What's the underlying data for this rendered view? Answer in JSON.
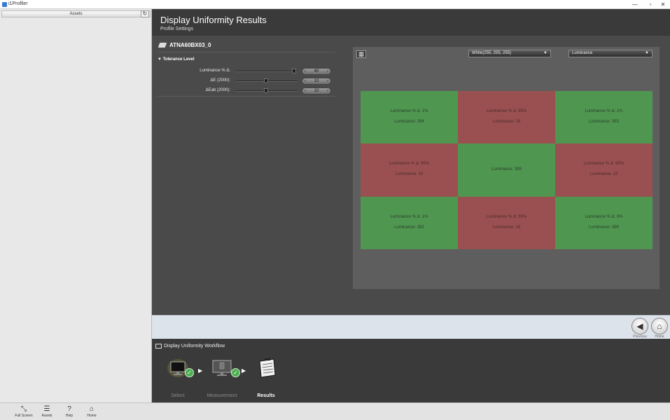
{
  "window": {
    "app_name": "i1Profiler"
  },
  "sidebar": {
    "header": "Assets"
  },
  "header": {
    "title": "Display Uniformity Results",
    "subtitle": "Profile Settings"
  },
  "device": {
    "name": "ATNA60BX03_0"
  },
  "tolerance": {
    "heading": "Tolerance Level",
    "rows": [
      {
        "label": "Luminance % Δ:",
        "value": "40",
        "level": 1.0
      },
      {
        "label": "ΔE (2000):",
        "value": "10",
        "level": 0.5
      },
      {
        "label": "ΔEab (2000):",
        "value": "10",
        "level": 0.5
      }
    ]
  },
  "grid": {
    "color_dropdown": "White(255, 255, 255)",
    "metric_dropdown": "Luminance",
    "cells": [
      {
        "status": "pass",
        "delta": "Luminance % Δ:  1%",
        "luminance": "Luminance:  394"
      },
      {
        "status": "fail",
        "delta": "Luminance % Δ:  95%",
        "luminance": "Luminance:  19"
      },
      {
        "status": "pass",
        "delta": "Luminance % Δ:  1%",
        "luminance": "Luminance:  393"
      },
      {
        "status": "fail",
        "delta": "Luminance % Δ:  95%",
        "luminance": "Luminance:  19"
      },
      {
        "status": "pass",
        "delta": "",
        "luminance": "Luminance:  398"
      },
      {
        "status": "fail",
        "delta": "Luminance % Δ:  95%",
        "luminance": "Luminance:  19"
      },
      {
        "status": "pass",
        "delta": "Luminance % Δ:  1%",
        "luminance": "Luminance:  392"
      },
      {
        "status": "fail",
        "delta": "Luminance % Δ:  95%",
        "luminance": "Luminance:  19"
      },
      {
        "status": "pass",
        "delta": "Luminance % Δ:  0%",
        "luminance": "Luminance:  396"
      }
    ],
    "colors": {
      "pass": "#4f9650",
      "fail": "#9a5050"
    }
  },
  "nav": {
    "previous": "Previous",
    "home": "Home"
  },
  "workflow": {
    "title": "Display Uniformity Workflow",
    "steps": [
      {
        "label": "Select",
        "done": true
      },
      {
        "label": "Measurement",
        "done": true
      },
      {
        "label": "Results",
        "done": false
      }
    ]
  },
  "bottombar": {
    "items": [
      "Full Screen",
      "Assets",
      "Help",
      "Home"
    ]
  }
}
